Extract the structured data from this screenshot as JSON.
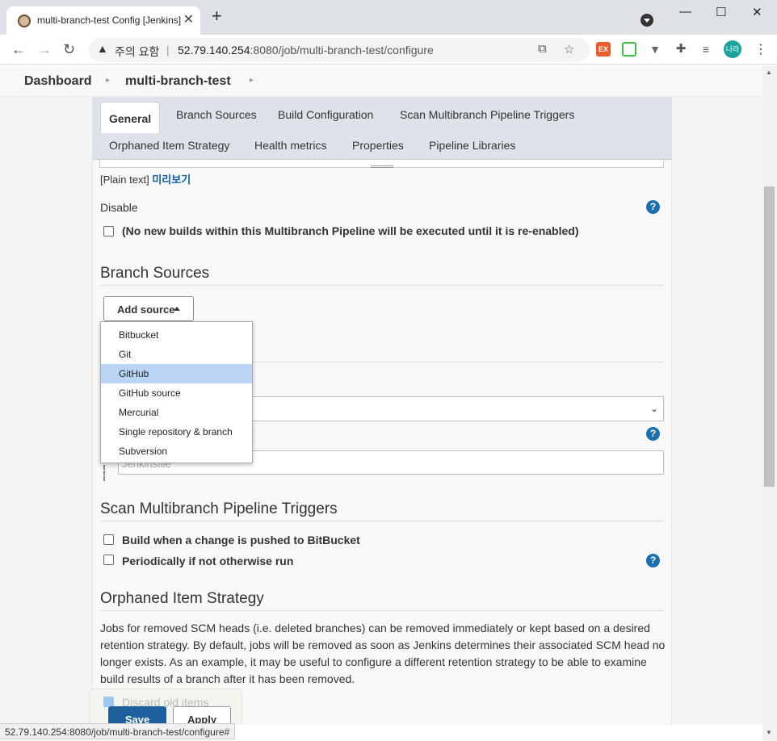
{
  "browser": {
    "tab_title": "multi-branch-test Config [Jenkins]",
    "tab_close": "✕",
    "new_tab": "+",
    "win_min": "—",
    "win_max": "☐",
    "win_close": "✕",
    "security_label": "주의 요함",
    "url_separator": "|",
    "url_host": "52.79.140.254",
    "url_path": ":8080/job/multi-branch-test/configure",
    "profile_label": "나라",
    "ext_ex_label": "EX",
    "status_url": "52.79.140.254:8080/job/multi-branch-test/configure#",
    "icons": [
      "back-icon",
      "forward-icon",
      "reload-icon",
      "warning-icon",
      "translate-icon",
      "star-icon",
      "puzzle-icon",
      "reading-list-icon",
      "menu-icon"
    ]
  },
  "breadcrumb": {
    "items": [
      "Dashboard",
      "multi-branch-test"
    ],
    "sep": "▸"
  },
  "config_tabs": {
    "row1": [
      "General",
      "Branch Sources",
      "Build Configuration",
      "Scan Multibranch Pipeline Triggers"
    ],
    "row2": [
      "Orphaned Item Strategy",
      "Health metrics",
      "Properties",
      "Pipeline Libraries"
    ],
    "active": "General"
  },
  "general": {
    "plain_text": "[Plain text]",
    "preview_link": "미리보기",
    "disable_label": "Disable",
    "disable_checkbox_label": "(No new builds within this Multibranch Pipeline will be executed until it is re-enabled)"
  },
  "branch_sources": {
    "title": "Branch Sources",
    "add_source_label": "Add source",
    "dropdown_items": [
      "Bitbucket",
      "Git",
      "GitHub",
      "GitHub source",
      "Mercurial",
      "Single repository & branch",
      "Subversion"
    ],
    "highlighted": "GitHub",
    "input_placeholder": "Jenkinsfile"
  },
  "triggers": {
    "title": "Scan Multibranch Pipeline Triggers",
    "option1": "Build when a change is pushed to BitBucket",
    "option2": "Periodically if not otherwise run"
  },
  "orphaned": {
    "title": "Orphaned Item Strategy",
    "description": "Jobs for removed SCM heads (i.e. deleted branches) can be removed immediately or kept based on a desired retention strategy. By default, jobs will be removed as soon as Jenkins determines their associated SCM head no longer exists. As an example, it may be useful to configure a different retention strategy to be able to examine build results of a branch after it has been removed.",
    "discard_label": "Discard old items"
  },
  "buttons": {
    "save": "Save",
    "apply": "Apply"
  },
  "help_glyph": "?",
  "select_caret": "⌄",
  "colors": {
    "accent": "#1a6fb0",
    "save_button": "#1e5f9e",
    "dropdown_highlight": "#b9d4f5",
    "tab_bar": "#dde3e8"
  }
}
